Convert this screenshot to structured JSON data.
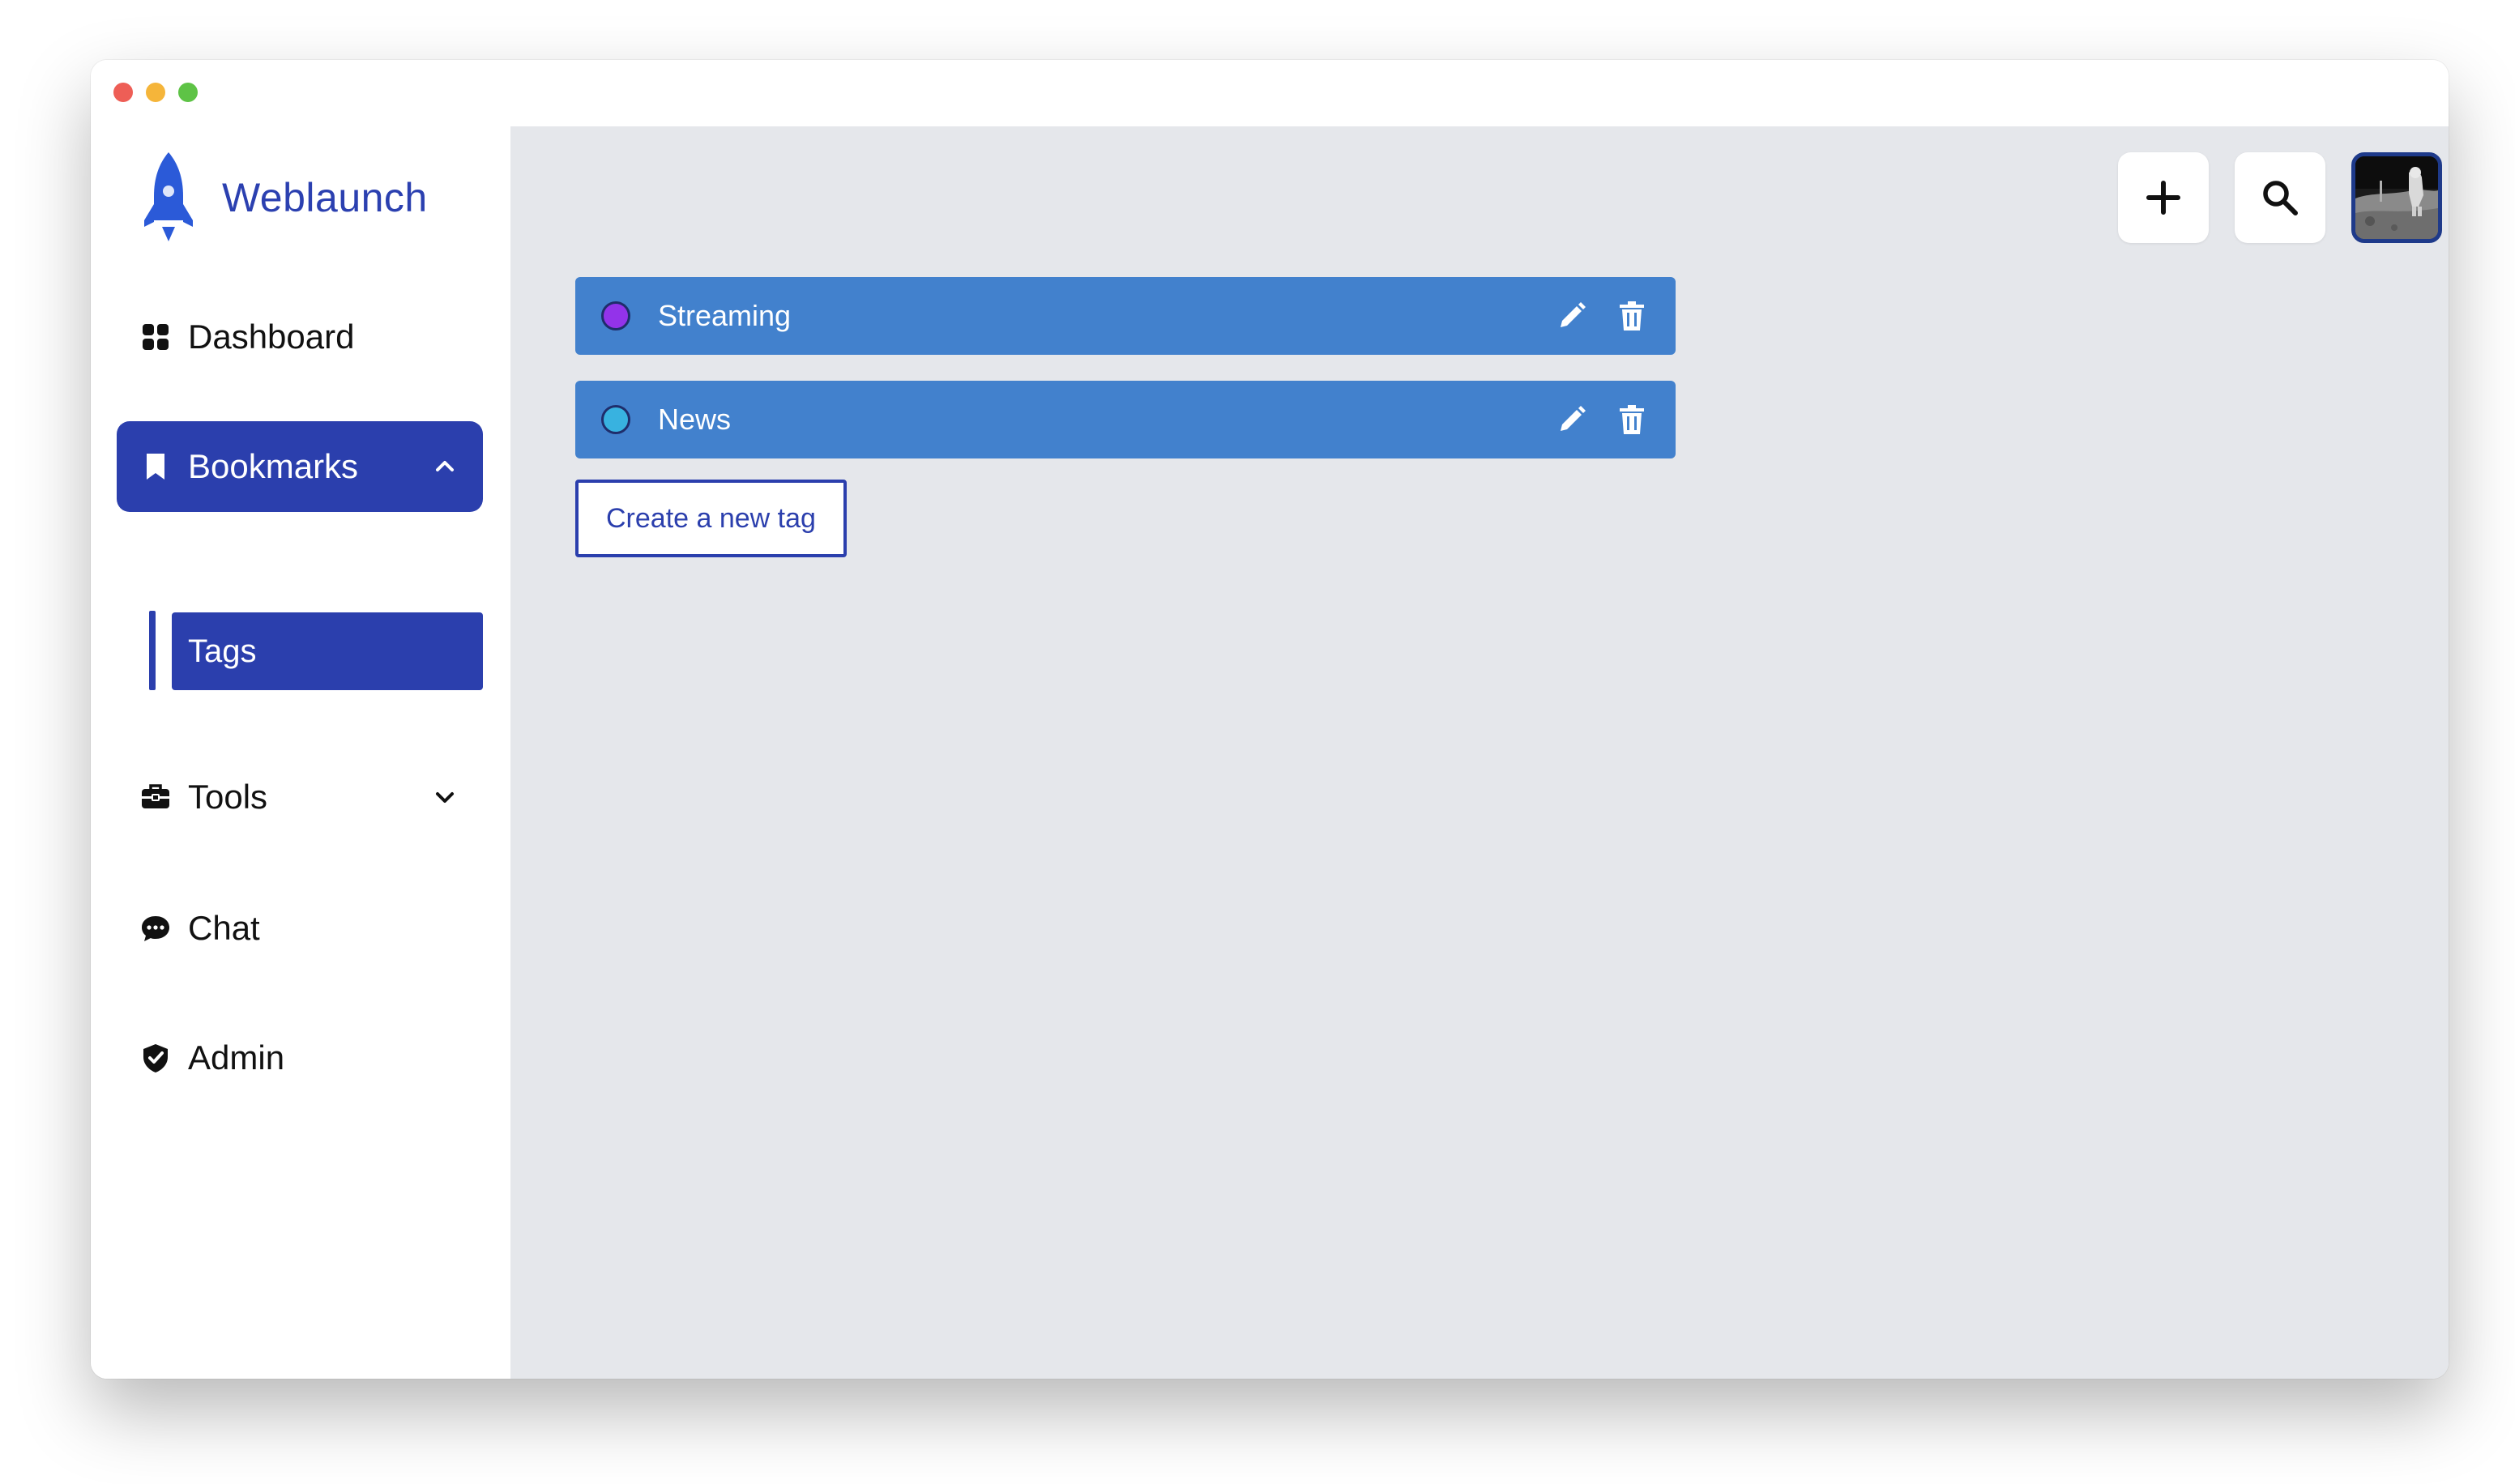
{
  "window": {
    "traffic_colors": {
      "close": "#ee5e56",
      "minimize": "#f5b53a",
      "maximize": "#5ec346"
    }
  },
  "brand": {
    "name": "Weblaunch",
    "icon": "rocket-icon",
    "color": "#2b40b0"
  },
  "sidebar": {
    "items": [
      {
        "label": "Dashboard",
        "icon": "grid-icon",
        "active": false
      },
      {
        "label": "Bookmarks",
        "icon": "bookmark-icon",
        "active": true,
        "expanded": true,
        "children": [
          {
            "label": "Tags",
            "active": true
          }
        ]
      },
      {
        "label": "Tools",
        "icon": "toolbox-icon",
        "active": false,
        "expanded": false
      },
      {
        "label": "Chat",
        "icon": "chat-bubble-icon",
        "active": false
      },
      {
        "label": "Admin",
        "icon": "shield-check-icon",
        "active": false
      }
    ],
    "active_color": "#2b3fad"
  },
  "topbar": {
    "add_icon": "plus-icon",
    "search_icon": "search-icon",
    "avatar_alt": "user-avatar"
  },
  "tags": [
    {
      "name": "Streaming",
      "color": "#9333ea",
      "edit_icon": "pencil-icon",
      "delete_icon": "trash-icon"
    },
    {
      "name": "News",
      "color": "#38b2e0",
      "edit_icon": "pencil-icon",
      "delete_icon": "trash-icon"
    }
  ],
  "tag_row_color": "#4281cd",
  "create_button": {
    "label": "Create a new tag"
  }
}
